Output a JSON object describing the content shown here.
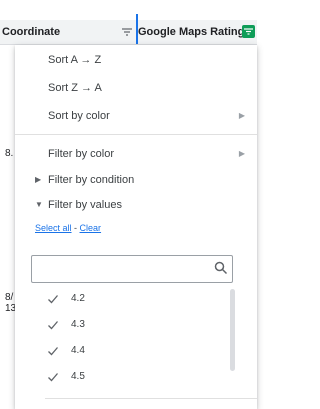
{
  "columns": {
    "coordinate": "Coordinate",
    "maps_rating": "Google Maps Rating"
  },
  "sheet_fragments": {
    "row_a": "8.",
    "row_b": "8/",
    "row_c": "13"
  },
  "menu": {
    "sort_az": "Sort A → Z",
    "sort_za": "Sort Z → A",
    "sort_color": "Sort by color",
    "filter_color": "Filter by color",
    "filter_condition": "Filter by condition",
    "filter_values": "Filter by values",
    "select_all": "Select all",
    "link_separator": " - ",
    "clear": "Clear",
    "search_placeholder": "",
    "values": [
      "4.2",
      "4.3",
      "4.4",
      "4.5"
    ]
  },
  "colors": {
    "accent": "#1a73e8",
    "filter_active": "#0f9d58"
  }
}
